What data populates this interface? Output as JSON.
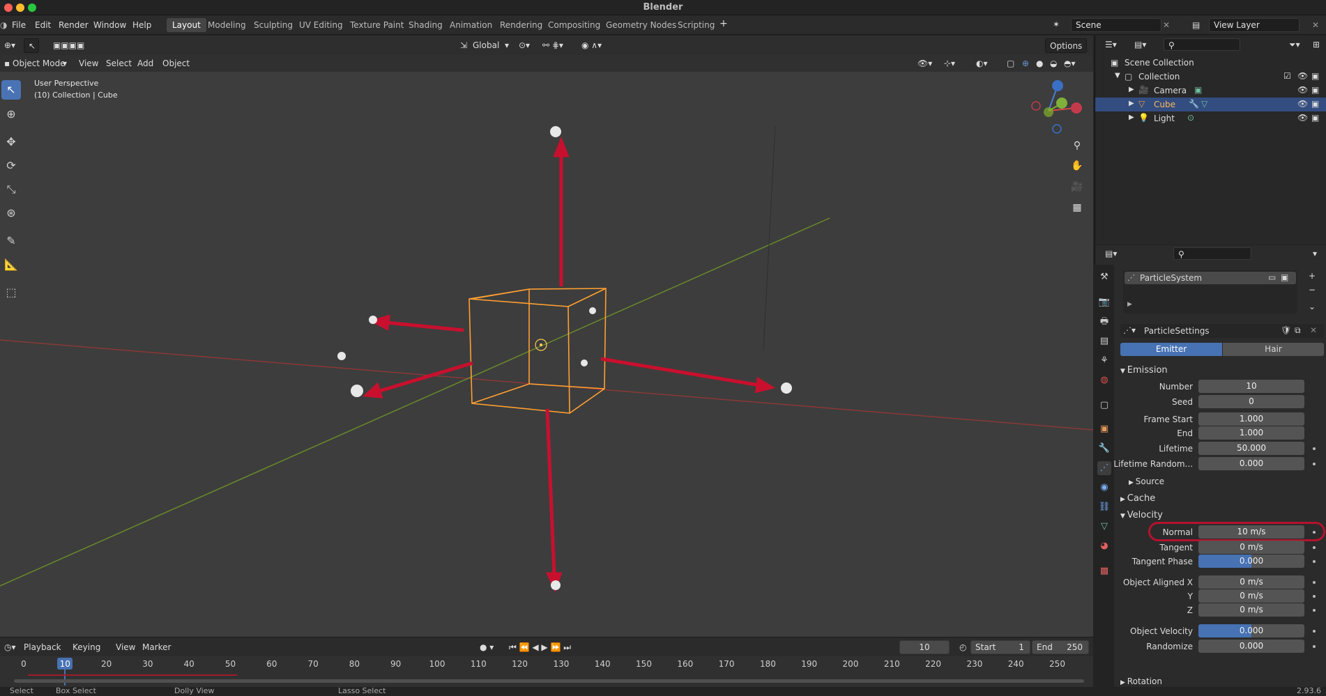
{
  "window": {
    "title": "Blender"
  },
  "menus": [
    "File",
    "Edit",
    "Render",
    "Window",
    "Help"
  ],
  "workspaces": [
    "Layout",
    "Modeling",
    "Sculpting",
    "UV Editing",
    "Texture Paint",
    "Shading",
    "Animation",
    "Rendering",
    "Compositing",
    "Geometry Nodes",
    "Scripting"
  ],
  "active_workspace": "Layout",
  "scene_name": "Scene",
  "view_layer": "View Layer",
  "viewport": {
    "mode": "Object Mode",
    "menus": [
      "View",
      "Select",
      "Add",
      "Object"
    ],
    "transform_orientation": "Global",
    "options_label": "Options",
    "overlay_line1": "User Perspective",
    "overlay_line2": "(10) Collection | Cube"
  },
  "outliner": {
    "rows": [
      {
        "label": "Scene Collection",
        "icon": "scene-collection-icon"
      },
      {
        "label": "Collection",
        "icon": "collection-icon"
      },
      {
        "label": "Camera",
        "icon": "camera-icon"
      },
      {
        "label": "Cube",
        "icon": "mesh-icon",
        "selected": true
      },
      {
        "label": "Light",
        "icon": "light-icon"
      }
    ]
  },
  "properties": {
    "particle_system": "ParticleSystem",
    "particle_settings": "ParticleSettings",
    "type_tabs": [
      "Emitter",
      "Hair"
    ],
    "active_type": "Emitter",
    "emission": {
      "header": "Emission",
      "number_label": "Number",
      "number": "10",
      "seed_label": "Seed",
      "seed": "0",
      "frame_start_label": "Frame Start",
      "frame_start": "1.000",
      "end_label": "End",
      "end": "1.000",
      "lifetime_label": "Lifetime",
      "lifetime": "50.000",
      "lifetime_random_label": "Lifetime Random...",
      "lifetime_random": "0.000",
      "source_label": "Source"
    },
    "cache_header": "Cache",
    "velocity": {
      "header": "Velocity",
      "normal_label": "Normal",
      "normal": "10 m/s",
      "tangent_label": "Tangent",
      "tangent": "0 m/s",
      "tangent_phase_label": "Tangent Phase",
      "tangent_phase": "0.000",
      "tangent_phase_fraction": 0.5,
      "aligned_x_label": "Object Aligned X",
      "aligned_x": "0 m/s",
      "aligned_y_label": "Y",
      "aligned_y": "0 m/s",
      "aligned_z_label": "Z",
      "aligned_z": "0 m/s",
      "object_velocity_label": "Object Velocity",
      "object_velocity": "0.000",
      "object_velocity_fraction": 0.5,
      "randomize_label": "Randomize",
      "randomize": "0.000"
    },
    "rotation_header": "Rotation"
  },
  "timeline": {
    "menus": [
      "Playback",
      "Keying",
      "View",
      "Marker"
    ],
    "current_frame": "10",
    "start_label": "Start",
    "start": "1",
    "end_label": "End",
    "end": "250",
    "ticks": [
      "0",
      "10",
      "20",
      "30",
      "40",
      "50",
      "60",
      "70",
      "80",
      "90",
      "100",
      "110",
      "120",
      "130",
      "140",
      "150",
      "160",
      "170",
      "180",
      "190",
      "200",
      "210",
      "220",
      "230",
      "240",
      "250"
    ]
  },
  "status": {
    "select": "Select",
    "box_select": "Box Select",
    "dolly": "Dolly View",
    "lasso": "Lasso Select",
    "version": "2.93.6"
  },
  "colors": {
    "accent": "#4772b3",
    "selection": "#ffa032",
    "arrow": "#c8102e",
    "highlight": "#b5122e"
  }
}
